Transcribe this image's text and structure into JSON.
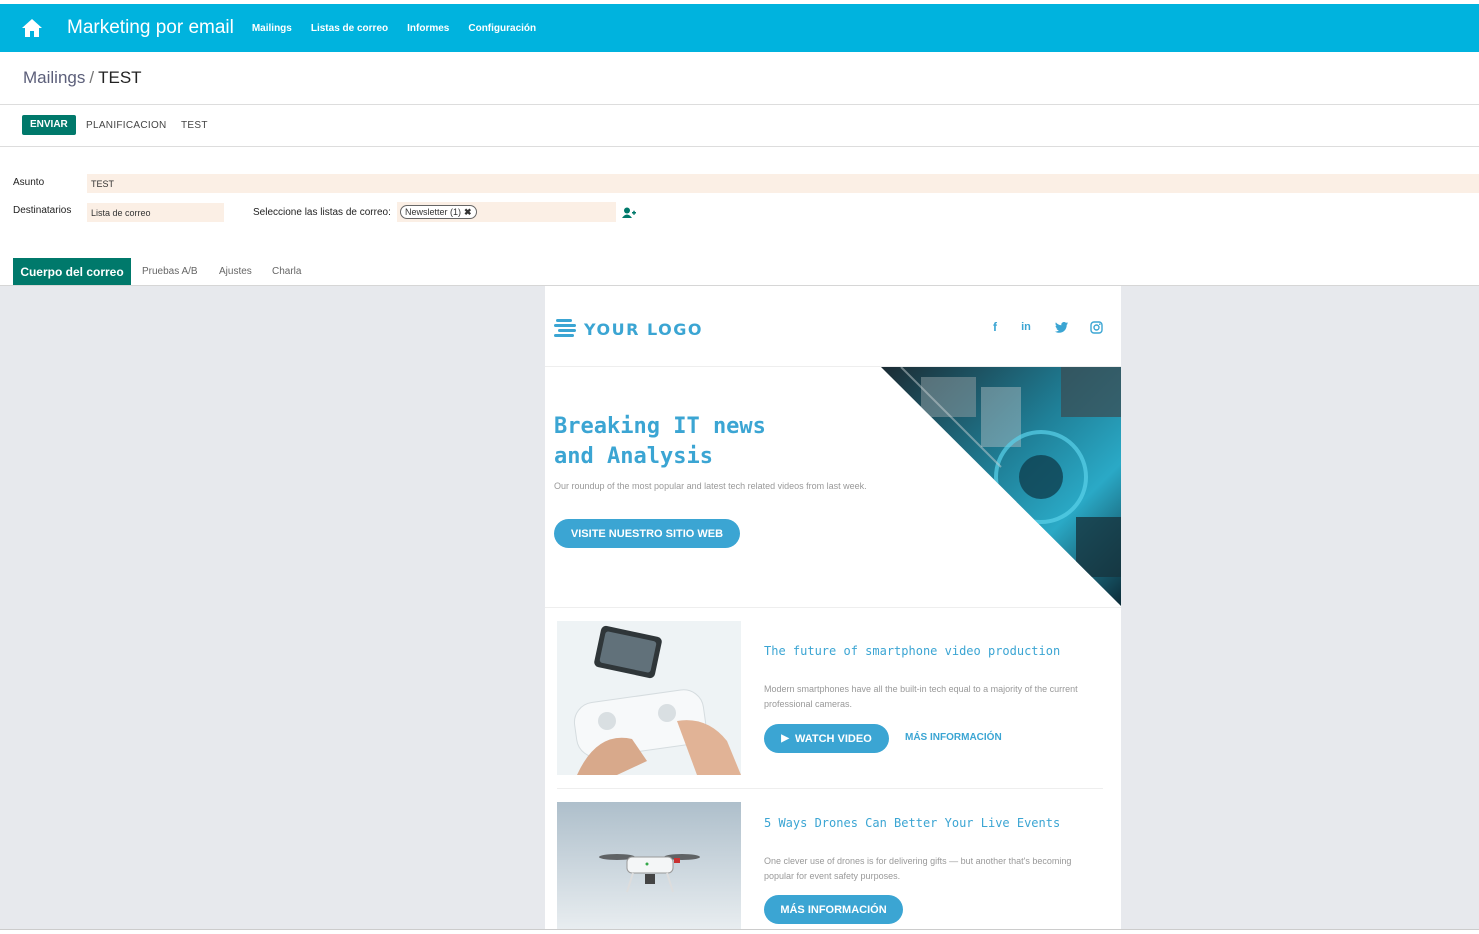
{
  "navbar": {
    "app_title": "Marketing por email",
    "items": [
      "Mailings",
      "Listas de correo",
      "Informes",
      "Configuración"
    ]
  },
  "breadcrumb": {
    "parent": "Mailings",
    "separator": "/",
    "current": "TEST"
  },
  "actions": {
    "send": "ENVIAR",
    "schedule": "PLANIFICACION",
    "test": "TEST"
  },
  "form": {
    "subject_label": "Asunto",
    "subject_value": "TEST",
    "recipients_label": "Destinatarios",
    "recipients_value": "Lista de correo",
    "lists_label": "Seleccione las listas de correo:",
    "list_tag": "Newsletter (1)"
  },
  "tabs": {
    "active": "Cuerpo del correo",
    "others": [
      "Pruebas A/B",
      "Ajustes",
      "Charla"
    ]
  },
  "email": {
    "logo_text": "YOUR LOGO",
    "hero_title_line1": "Breaking IT news",
    "hero_title_line2": "and Analysis",
    "hero_subtitle": "Our roundup of the most popular and latest tech related videos from last week.",
    "hero_button": "VISITE NUESTRO SITIO WEB",
    "card1_title": "The future of smartphone video production",
    "card1_text": "Modern smartphones have all the built-in tech equal to a majority of the current professional cameras.",
    "card1_button": "WATCH VIDEO",
    "card1_link": "MÁS INFORMACIÓN",
    "card2_title": "5 Ways Drones Can Better Your Live Events",
    "card2_text": "One clever use of drones is for delivering gifts — but another that's becoming popular for event safety purposes.",
    "card2_button": "MÁS INFORMACIÓN"
  },
  "colors": {
    "navbar": "#00b3de",
    "primary": "#00796b",
    "accent": "#3ba5d3",
    "field_bg": "#fbefe5"
  },
  "icons": [
    "home-icon",
    "add-user-icon",
    "facebook-icon",
    "linkedin-icon",
    "twitter-icon",
    "instagram-icon",
    "play-icon",
    "remove-tag-icon"
  ]
}
